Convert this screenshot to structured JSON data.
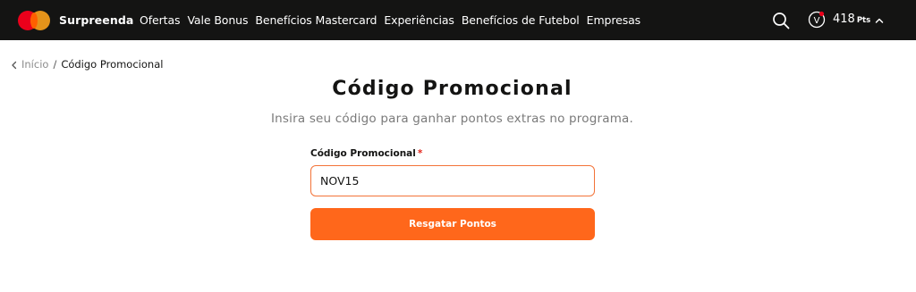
{
  "header": {
    "brand": "Surpreenda",
    "nav": [
      "Ofertas",
      "Vale Bonus",
      "Benefícios Mastercard",
      "Experiências",
      "Benefícios de Futebol",
      "Empresas"
    ],
    "points_value": "418",
    "points_unit": "Pts",
    "badge_letter": "V",
    "icons": {
      "search": "search-icon",
      "badge": "v-badge-icon",
      "chevron": "chevron-up-icon"
    },
    "logo_colors": {
      "red": "#eb001b",
      "orange": "#f79e1b"
    }
  },
  "breadcrumb": {
    "home": "Início",
    "separator": "/",
    "current": "Código Promocional"
  },
  "main": {
    "title": "Código Promocional",
    "subtitle": "Insira seu código para ganhar pontos extras no programa.",
    "field": {
      "label": "Código Promocional",
      "required_mark": "*",
      "value": "NOV15",
      "placeholder": ""
    },
    "submit_label": "Resgatar Pontos"
  },
  "colors": {
    "topbar": "#141413",
    "accent": "#ff671b",
    "input_border": "#f37338",
    "required": "#e3261b"
  }
}
